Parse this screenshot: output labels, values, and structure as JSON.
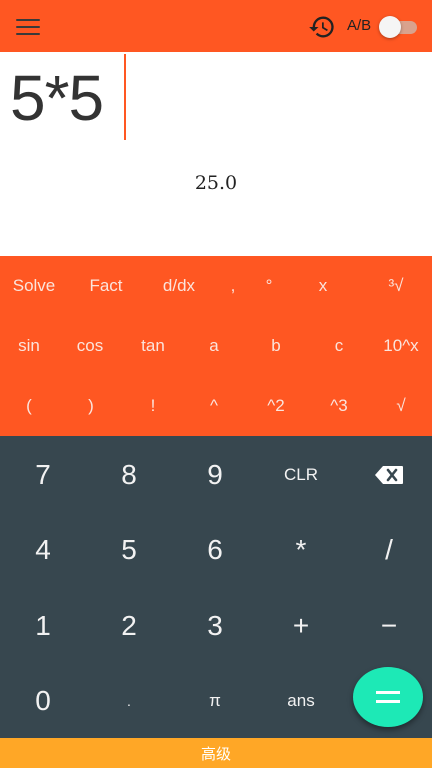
{
  "topbar": {
    "menu_icon": "hamburger-menu-icon",
    "history_icon": "history-icon",
    "ab_label": "A/B",
    "ab_toggle_on": false,
    "color": "#ff5722"
  },
  "display": {
    "expression": "5*5",
    "result": "25.0",
    "cursor_color": "#ff5722"
  },
  "scientific": {
    "rows": [
      [
        "Solve",
        "Fact",
        "d/dx",
        ",",
        "°",
        "x",
        "³√"
      ],
      [
        "sin",
        "cos",
        "tan",
        "a",
        "b",
        "c",
        "10^x"
      ],
      [
        "(",
        ")",
        "!",
        "^",
        "^2",
        "^3",
        "√"
      ]
    ],
    "background": "#ff5722"
  },
  "keypad": {
    "rows": [
      [
        "7",
        "8",
        "9",
        "CLR",
        ""
      ],
      [
        "4",
        "5",
        "6",
        "*",
        "/"
      ],
      [
        "1",
        "2",
        "3",
        "+",
        "−"
      ],
      [
        "0",
        ".",
        "π",
        "ans",
        ""
      ]
    ],
    "backspace_icon": "backspace-icon",
    "equals_icon": "equals-icon",
    "background": "#37474f",
    "fab_color": "#1de9b6"
  },
  "bottom_bar": {
    "label": "高级",
    "color": "#ffa726"
  }
}
